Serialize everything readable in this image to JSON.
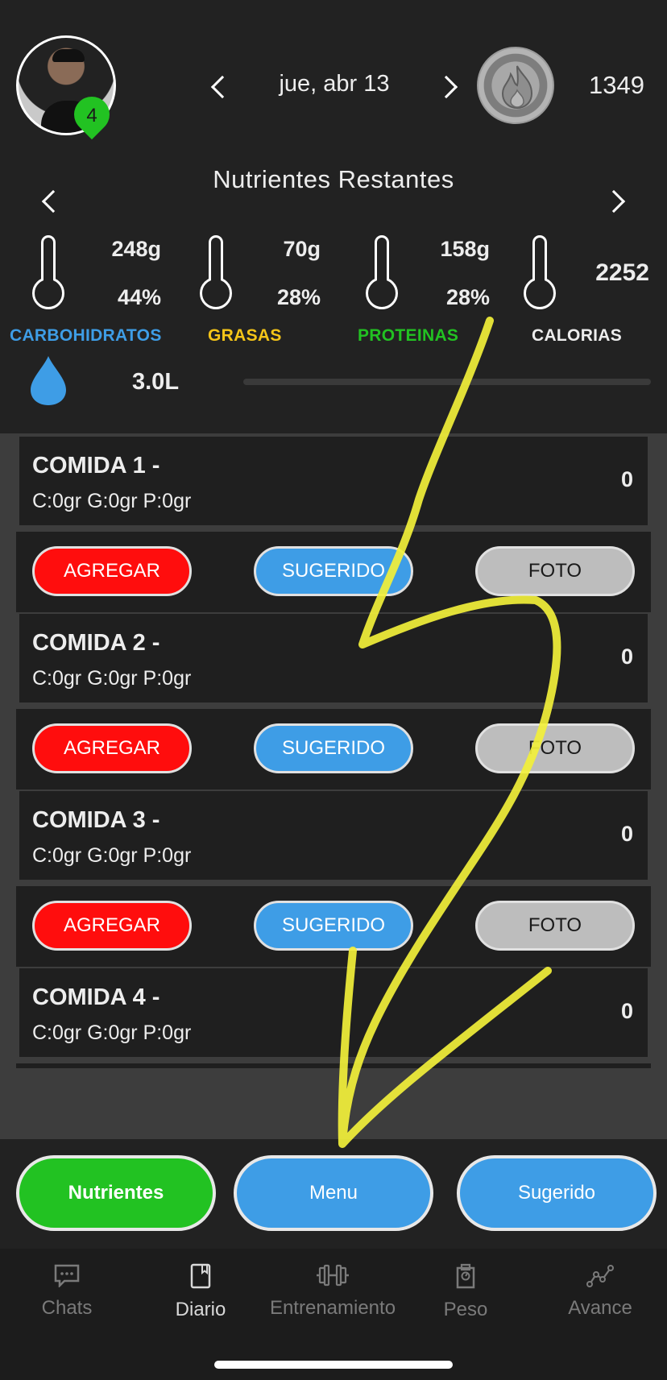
{
  "header": {
    "avatar_badge": "4",
    "date": "jue, abr 13",
    "calories_count": "1349",
    "section_title": "Nutrientes Restantes"
  },
  "nutrients": {
    "carbs": {
      "grams": "248g",
      "percent": "44%",
      "label": "CARBOHIDRATOS",
      "color": "#3e9de6"
    },
    "fats": {
      "grams": "70g",
      "percent": "28%",
      "label": "GRASAS",
      "color": "#f5c518"
    },
    "proteins": {
      "grams": "158g",
      "percent": "28%",
      "label": "PROTEINAS",
      "color": "#22c222"
    },
    "calories": {
      "value": "2252",
      "label": "CALORIAS",
      "color": "#ededed"
    },
    "water": {
      "value": "3.0L",
      "progress": 0
    }
  },
  "meals": [
    {
      "title": "COMIDA 1 -",
      "macros": "C:0gr G:0gr P:0gr",
      "total": "0"
    },
    {
      "title": "COMIDA 2 -",
      "macros": "C:0gr G:0gr P:0gr",
      "total": "0"
    },
    {
      "title": "COMIDA 3 -",
      "macros": "C:0gr G:0gr P:0gr",
      "total": "0"
    },
    {
      "title": "COMIDA 4 -",
      "macros": "C:0gr G:0gr P:0gr",
      "total": "0"
    }
  ],
  "meal_actions": {
    "add": "AGREGAR",
    "suggested": "SUGERIDO",
    "photo": "FOTO"
  },
  "bottom_buttons": {
    "nutrients": "Nutrientes",
    "menu": "Menu",
    "suggested": "Sugerido"
  },
  "tabs": [
    {
      "label": "Chats",
      "icon": "chat-icon",
      "active": false
    },
    {
      "label": "Diario",
      "icon": "notebook-icon",
      "active": true
    },
    {
      "label": "Entrenamiento",
      "icon": "dumbbell-icon",
      "active": false
    },
    {
      "label": "Peso",
      "icon": "scale-icon",
      "active": false
    },
    {
      "label": "Avance",
      "icon": "progress-chart-icon",
      "active": false
    }
  ],
  "colors": {
    "add": "#ff0d0d",
    "suggested": "#3e9de6",
    "photo": "#bdbdbd",
    "nutrients_button": "#22c222",
    "annotation": "#f2f03a"
  }
}
